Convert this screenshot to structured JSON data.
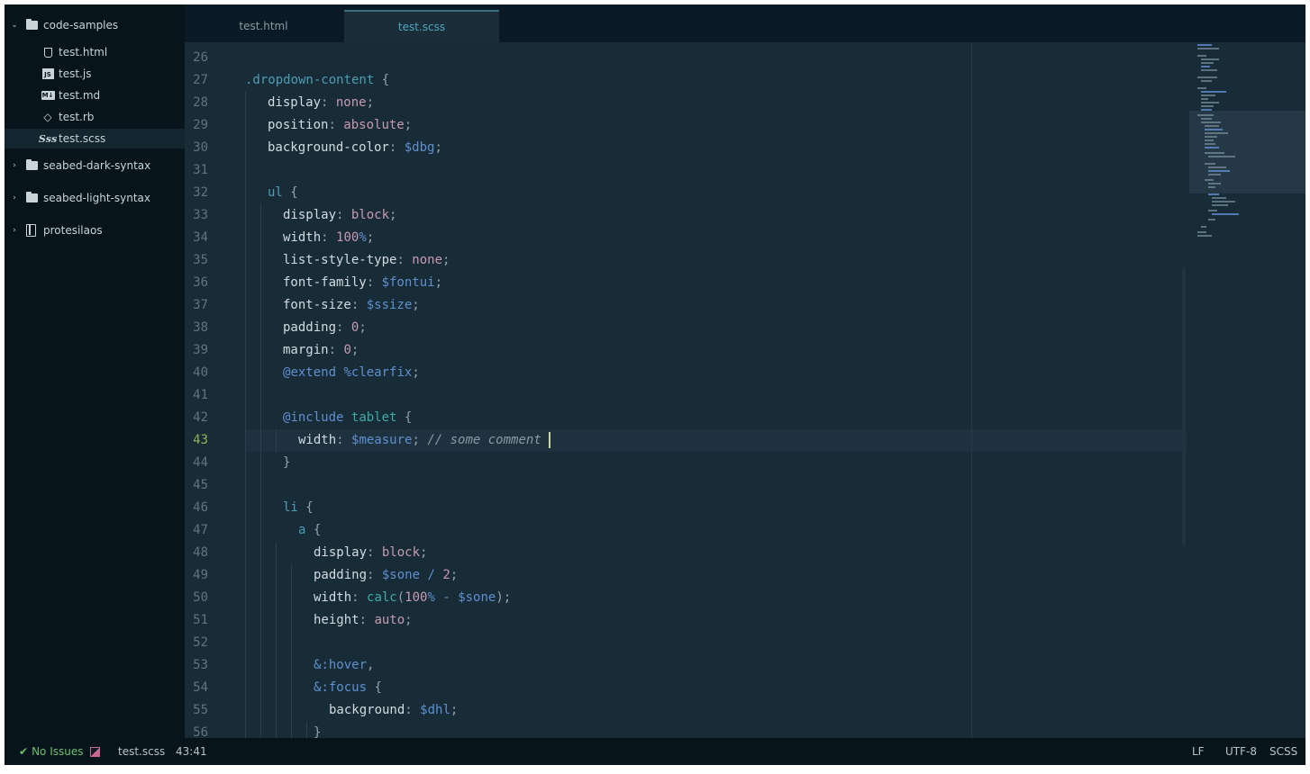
{
  "sidebar": {
    "root_folder": "code-samples",
    "files": [
      {
        "name": "test.html",
        "icon": "html5-icon"
      },
      {
        "name": "test.js",
        "icon": "js-icon"
      },
      {
        "name": "test.md",
        "icon": "markdown-icon"
      },
      {
        "name": "test.rb",
        "icon": "ruby-icon"
      },
      {
        "name": "test.scss",
        "icon": "sass-icon",
        "selected": true
      }
    ],
    "folders": [
      "seabed-dark-syntax",
      "seabed-light-syntax"
    ],
    "repo": "protesilaos",
    "file_icon_glyphs": {
      "js": "JS",
      "md": "M↓",
      "rb": "◇",
      "scss": "Sss"
    }
  },
  "tabs": [
    {
      "label": "test.html",
      "active": false
    },
    {
      "label": "test.scss",
      "active": true
    }
  ],
  "editor": {
    "line_numbers": [
      "26",
      "27",
      "28",
      "29",
      "30",
      "31",
      "32",
      "33",
      "34",
      "35",
      "36",
      "37",
      "38",
      "39",
      "40",
      "41",
      "42",
      "43",
      "44",
      "45",
      "46",
      "47",
      "48",
      "49",
      "50",
      "51",
      "52",
      "53",
      "54",
      "55",
      "56"
    ],
    "current_line": "43",
    "code": {
      "l27_sel": ".dropdown-content",
      "l27_brace": " {",
      "l28_prop": "display",
      "l28_val": "none",
      "l29_prop": "position",
      "l29_val": "absolute",
      "l30_prop": "background-color",
      "l30_val": "$dbg",
      "l32_sel": "ul",
      "l32_brace": " {",
      "l33_prop": "display",
      "l33_val": "block",
      "l34_prop": "width",
      "l34_num": "100",
      "l34_unit": "%",
      "l35_prop": "list-style-type",
      "l35_val": "none",
      "l36_prop": "font-family",
      "l36_val": "$fontui",
      "l37_prop": "font-size",
      "l37_val": "$ssize",
      "l38_prop": "padding",
      "l38_val": "0",
      "l39_prop": "margin",
      "l39_val": "0",
      "l40_at": "@",
      "l40_kw": "extend",
      "l40_pct": "%",
      "l40_name": "clearfix",
      "l42_at": "@",
      "l42_kw": "include",
      "l42_name": "tablet",
      "l42_brace": " {",
      "l43_prop": "width",
      "l43_val": "$measure",
      "l43_comment": "// some comment",
      "l44_brace": "}",
      "l46_sel": "li",
      "l46_brace": " {",
      "l47_sel": "a",
      "l47_brace": " {",
      "l48_prop": "display",
      "l48_val": "block",
      "l49_prop": "padding",
      "l49_var": "$sone",
      "l49_op": " / ",
      "l49_num": "2",
      "l50_prop": "width",
      "l50_fn": "calc",
      "l50_num": "100",
      "l50_unit": "%",
      "l50_op": " - ",
      "l50_var": "$sone",
      "l51_prop": "height",
      "l51_val": "auto",
      "l53_amp": "&",
      "l53_pseudo": ":hover",
      "l54_amp": "&",
      "l54_pseudo": ":focus",
      "l54_brace": " {",
      "l55_prop": "background",
      "l55_val": "$dhl",
      "l56_brace": "}"
    }
  },
  "statusbar": {
    "issues": "No Issues",
    "file": "test.scss",
    "cursor": "43:41",
    "line_ending": "LF",
    "encoding": "UTF-8",
    "grammar": "SCSS"
  },
  "colors": {
    "background": "#182c37",
    "sidebar": "#08141c",
    "selector": "#4e9bb4",
    "variable": "#5f8fd0",
    "value": "#c79ab0",
    "function": "#3faaa4",
    "ok": "#6fbf73"
  }
}
